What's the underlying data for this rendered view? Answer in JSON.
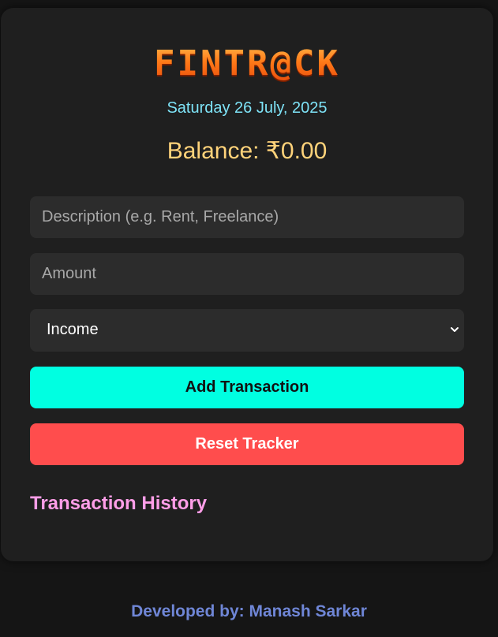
{
  "app": {
    "logo": "FINTR@CK",
    "date": "Saturday 26 July, 2025",
    "balance": "Balance: ₹0.00"
  },
  "form": {
    "description_placeholder": "Description (e.g. Rent, Freelance)",
    "description_value": "",
    "amount_placeholder": "Amount",
    "amount_value": "",
    "type_selected": "Income",
    "add_label": "Add Transaction",
    "reset_label": "Reset Tracker"
  },
  "history": {
    "title": "Transaction History"
  },
  "footer": {
    "text": "Developed by: Manash Sarkar"
  },
  "colors": {
    "accent_add": "#00ffe1",
    "accent_reset": "#ff4d4d",
    "balance": "#ffd37a",
    "date": "#7ee3f7",
    "history_title": "#ff9ee8",
    "footer": "#6f86d6"
  },
  "icons": {
    "select_arrow": "chevron-down-icon"
  }
}
